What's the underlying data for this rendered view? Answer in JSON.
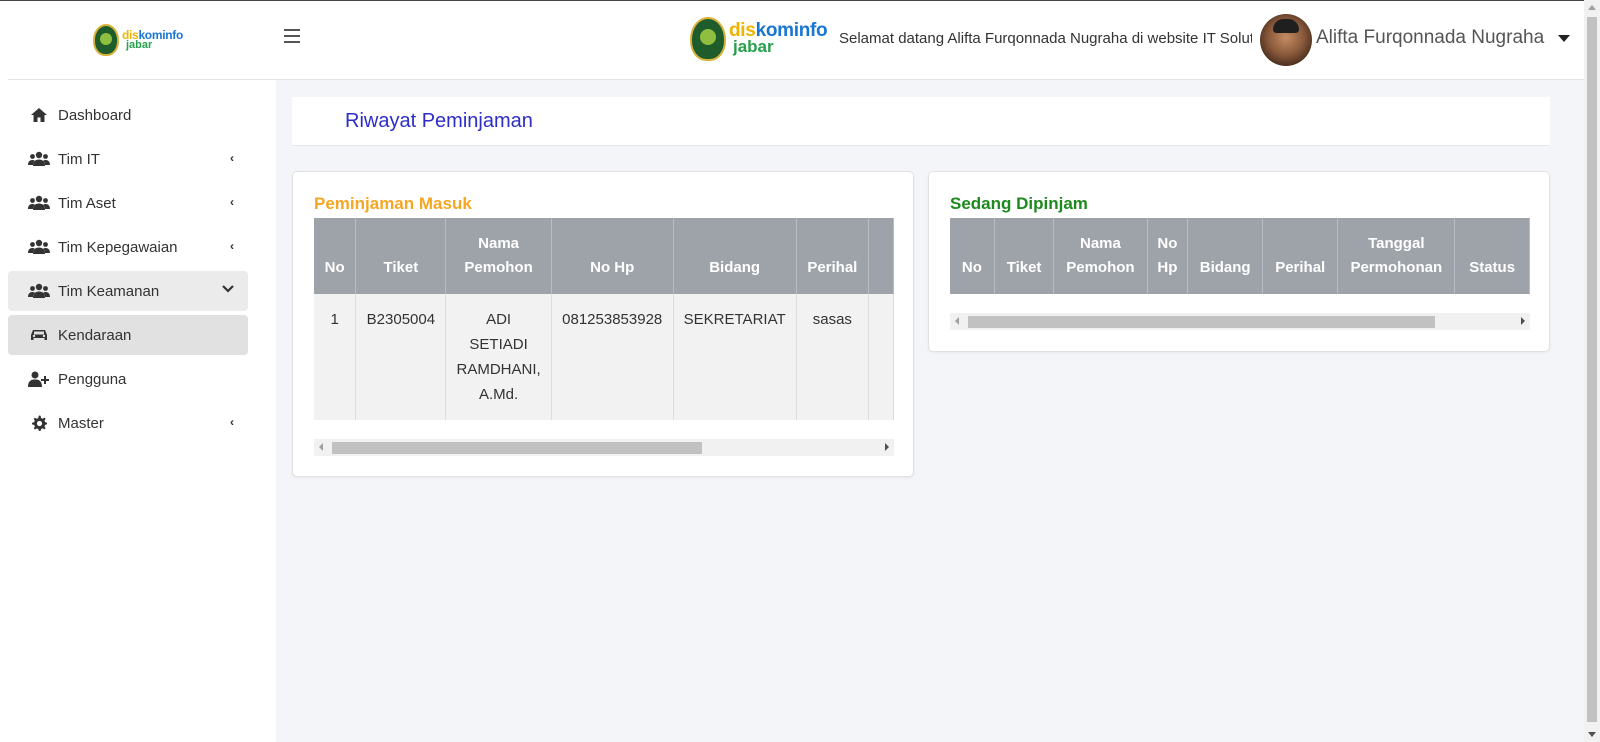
{
  "brand": {
    "logo_line1_a": "dis",
    "logo_line1_b": "kominfo",
    "logo_line2": "jabar"
  },
  "sidebar": {
    "items": [
      {
        "label": "Dashboard",
        "icon": "home-icon",
        "chevron": ""
      },
      {
        "label": "Tim IT",
        "icon": "users-icon",
        "chevron": "‹"
      },
      {
        "label": "Tim Aset",
        "icon": "users-icon",
        "chevron": "‹"
      },
      {
        "label": "Tim Kepegawaian",
        "icon": "users-icon",
        "chevron": "‹"
      },
      {
        "label": "Tim Keamanan",
        "icon": "users-icon",
        "chevron": "⌄"
      },
      {
        "label": "Kendaraan",
        "icon": "car-icon",
        "chevron": ""
      },
      {
        "label": "Pengguna",
        "icon": "user-plus-icon",
        "chevron": ""
      },
      {
        "label": "Master",
        "icon": "gear-icon",
        "chevron": "‹"
      }
    ]
  },
  "header": {
    "welcome": "Selamat datang Alifta Furqonnada Nugraha di website IT Solution Diskominfo Jabar",
    "username": "Alifta Furqonnada Nugraha"
  },
  "page": {
    "title": "Riwayat Peminjaman"
  },
  "incoming": {
    "title": "Peminjaman Masuk",
    "title_color": "#f5a623",
    "columns": [
      "No",
      "Tiket",
      "Nama Pemohon",
      "No Hp",
      "Bidang",
      "Perihal"
    ],
    "rows": [
      [
        "1",
        "B2305004",
        "ADI SETIADI RAMDHANI, A.Md.",
        "081253853928",
        "SEKRETARIAT",
        "sasas"
      ]
    ]
  },
  "borrowed": {
    "title": "Sedang Dipinjam",
    "title_color": "#1e8a1e",
    "columns": [
      "No",
      "Tiket",
      "Nama Pemohon",
      "No Hp",
      "Bidang",
      "Perihal",
      "Tanggal Permohonan",
      "Status"
    ],
    "rows": []
  }
}
